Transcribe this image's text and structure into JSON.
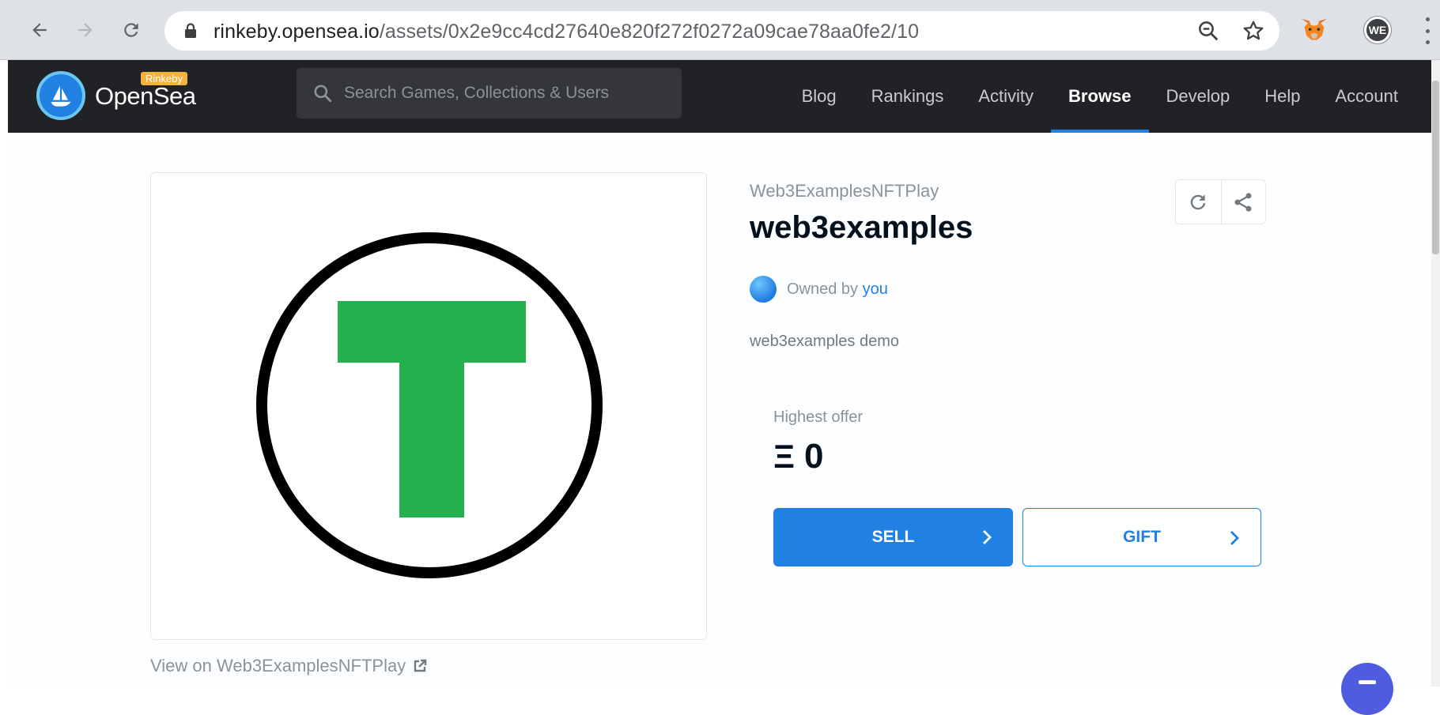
{
  "browser": {
    "url_domain": "rinkeby.opensea.io",
    "url_path": "/assets/0x2e9cc4cd27640e820f272f0272a09cae78aa0fe2/10",
    "extension_we_label": "WE"
  },
  "header": {
    "brand": "OpenSea",
    "network_badge": "Rinkeby",
    "search_placeholder": "Search Games, Collections & Users",
    "search_value": "",
    "nav": [
      {
        "label": "Blog"
      },
      {
        "label": "Rankings"
      },
      {
        "label": "Activity"
      },
      {
        "label": "Browse",
        "active": true
      },
      {
        "label": "Develop"
      },
      {
        "label": "Help"
      },
      {
        "label": "Account"
      }
    ]
  },
  "asset": {
    "image_letter": "T",
    "image_accent": "#22b14c",
    "view_link": "View on Web3ExamplesNFTPlay",
    "collection": "Web3ExamplesNFTPlay",
    "title": "web3examples",
    "owned_by_prefix": "Owned by",
    "owner": "you",
    "description": "web3examples demo"
  },
  "offer": {
    "label": "Highest offer",
    "currency_symbol": "Ξ",
    "amount": "0"
  },
  "buttons": {
    "sell": "SELL",
    "gift": "GIFT"
  },
  "colors": {
    "accent": "#2081e2",
    "header_bg": "#202225"
  }
}
